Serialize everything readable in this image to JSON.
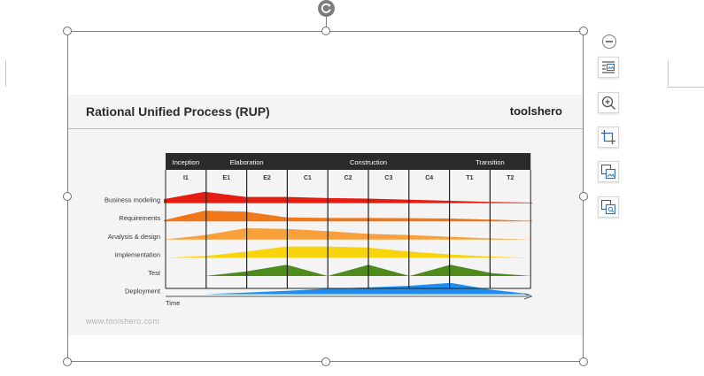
{
  "figure": {
    "title": "Rational Unified Process (RUP)",
    "brand": "toolshero",
    "url": "www.toolshero.com",
    "time_label": "Time"
  },
  "colors": {
    "header_bg": "#2b2b2b",
    "title_rule": "#8fd6b0",
    "selection_border": "#7f7f7f"
  },
  "toolbar": {
    "collapse_icon": "minus-circle-icon",
    "tools": [
      {
        "name": "layout-options",
        "icon": "text-wrap-icon"
      },
      {
        "name": "zoom",
        "icon": "zoom-in-icon"
      },
      {
        "name": "crop",
        "icon": "crop-icon"
      },
      {
        "name": "replace-picture",
        "icon": "replace-image-icon"
      },
      {
        "name": "alt-text",
        "icon": "alt-text-icon"
      }
    ]
  },
  "chart_data": {
    "type": "area",
    "phases": [
      {
        "name": "Inception",
        "iterations": [
          "I1"
        ]
      },
      {
        "name": "Elaboration",
        "iterations": [
          "E1",
          "E2"
        ]
      },
      {
        "name": "Construction",
        "iterations": [
          "C1",
          "C2",
          "C3",
          "C4"
        ]
      },
      {
        "name": "Transition",
        "iterations": [
          "T1",
          "T2"
        ]
      }
    ],
    "iterations": [
      "I1",
      "E1",
      "E2",
      "C1",
      "C2",
      "C3",
      "C4",
      "T1",
      "T2"
    ],
    "xlabel": "Time",
    "disciplines": [
      {
        "name": "Business modeling",
        "color": "#e31e10",
        "effort": [
          0.35,
          1.0,
          0.55,
          0.55,
          0.45,
          0.4,
          0.3,
          0.2,
          0.1,
          0.05
        ]
      },
      {
        "name": "Requirements",
        "color": "#f07818",
        "effort": [
          0.1,
          0.95,
          0.85,
          0.35,
          0.3,
          0.3,
          0.28,
          0.25,
          0.15,
          0.05
        ]
      },
      {
        "name": "Analysis & design",
        "color": "#f9a03a",
        "effort": [
          0.0,
          0.4,
          1.0,
          0.95,
          0.75,
          0.5,
          0.4,
          0.25,
          0.1,
          0.0
        ]
      },
      {
        "name": "Implementation",
        "color": "#f8d40c",
        "effort": [
          0.0,
          0.15,
          0.55,
          1.0,
          1.0,
          0.9,
          0.55,
          0.3,
          0.1,
          0.0
        ]
      },
      {
        "name": "Test",
        "color": "#4e8a1c",
        "effort": [
          0.0,
          0.0,
          0.4,
          1.0,
          0.0,
          1.0,
          0.0,
          1.0,
          0.25,
          0.0
        ]
      },
      {
        "name": "Deployment",
        "color": "#1f8ef0",
        "effort": [
          0.0,
          0.0,
          0.15,
          0.3,
          0.5,
          0.6,
          0.75,
          1.0,
          0.4,
          0.0
        ]
      }
    ]
  }
}
